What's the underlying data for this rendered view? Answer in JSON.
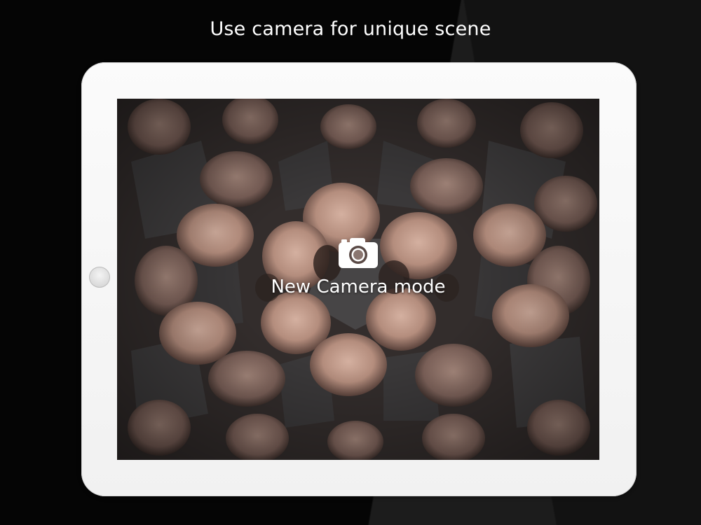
{
  "headline": "Use camera for unique scene",
  "screen": {
    "camera_button_label": "New Camera mode",
    "camera_icon": "camera-icon",
    "background_description_colors": {
      "skin": "#c9a493",
      "skin_shadow": "#6e5046",
      "hair": "#2a1f1c",
      "dark_facet": "#3c3a3b"
    }
  },
  "device": {
    "frame_color": "#f5f5f5",
    "home_button_icon": "home-button"
  },
  "colors": {
    "background_left": "#050505",
    "background_right": "#1c1c1c",
    "text": "#ffffff"
  }
}
